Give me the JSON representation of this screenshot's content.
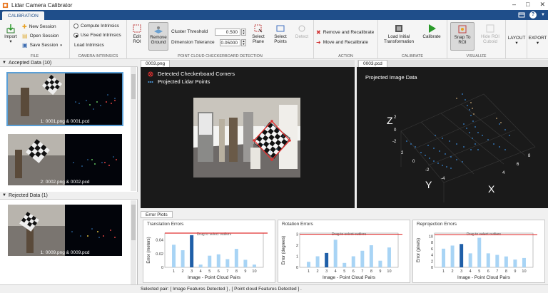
{
  "window": {
    "title": "Lidar Camera Calibrator"
  },
  "tabs": {
    "calibration": "CALIBRATION"
  },
  "ribbon": {
    "file": {
      "label": "FILE",
      "import": "Import",
      "new_session": "New Session",
      "open_session": "Open Session",
      "save_session": "Save Session"
    },
    "intrinsics": {
      "label": "CAMERA INTRINSICS",
      "compute": "Compute Intrinsics",
      "use_fixed": "Use Fixed Intrinsics",
      "load": "Load Intrinsics"
    },
    "detection": {
      "label": "POINT CLOUD CHECKERBOARD DETECTION",
      "edit_roi": "Edit ROI",
      "remove_ground": "Remove Ground",
      "cluster_threshold_label": "Cluster Threshold",
      "cluster_threshold_value": "0.500",
      "dimension_tolerance_label": "Dimension Tolerance",
      "dimension_tolerance_value": "0.05000",
      "select_plane": "Select Plane",
      "select_points": "Select Points",
      "detect": "Detect"
    },
    "action": {
      "label": "ACTION",
      "remove_recalibrate": "Remove and Recalibrate",
      "move_recalibrate": "Move and Recalibrate"
    },
    "calibrate": {
      "label": "CALIBRATE",
      "load_initial": "Load Initial Transformation",
      "calibrate": "Calibrate"
    },
    "visualize": {
      "label": "VISUALIZE",
      "snap_to_roi": "Snap To ROI",
      "hide_roi": "Hide ROI Cuboid"
    },
    "layout": {
      "label": "LAYOUT"
    },
    "export": {
      "label": "EXPORT"
    }
  },
  "left_panel": {
    "accepted_header": "Accepted Data (10)",
    "rejected_header": "Rejected Data (1)",
    "accepted": [
      {
        "caption": "1: 0001.png & 0001.pcd"
      },
      {
        "caption": "2: 0002.png & 0002.pcd"
      }
    ],
    "rejected": [
      {
        "caption": "1: 0009.png & 0009.pcd"
      }
    ]
  },
  "image_view": {
    "tab": "0003.png",
    "legend_corners": "Detected Checkerboard Corners",
    "legend_lidar": "Projected Lidar Points"
  },
  "pcd_view": {
    "tab": "0003.pcd",
    "title": "Projected Image Data",
    "axis_x": "X",
    "axis_y": "Y",
    "axis_z": "Z",
    "ticks_x": [
      "4",
      "6",
      "8"
    ],
    "ticks_y": [
      "-4",
      "-2",
      "0",
      "2"
    ],
    "ticks_z": [
      "2",
      "0",
      "-2"
    ]
  },
  "errors": {
    "tab": "Error Plots",
    "banner": "Drag to select outliers",
    "xlabel": "Image - Point Cloud Pairs",
    "colors": {
      "bar": "#a8d4f5",
      "selected": "#1f5fa8",
      "line": "#e03030"
    },
    "chart_data": [
      {
        "type": "bar",
        "title": "Translation Errors",
        "ylabel": "Error (meters)",
        "categories": [
          "1",
          "2",
          "3",
          "4",
          "5",
          "6",
          "7",
          "8",
          "9",
          "10"
        ],
        "values": [
          0.033,
          0.025,
          0.047,
          0.004,
          0.017,
          0.019,
          0.012,
          0.027,
          0.011,
          0.004
        ],
        "selected_index": 2,
        "threshold": 0.05,
        "ylim": [
          0,
          0.05
        ],
        "yticks": [
          "0",
          "0.02",
          "0.04"
        ]
      },
      {
        "type": "bar",
        "title": "Rotation Errors",
        "ylabel": "Error (degrees)",
        "categories": [
          "1",
          "2",
          "3",
          "4",
          "5",
          "6",
          "7",
          "8",
          "9",
          "10"
        ],
        "values": [
          0.5,
          1.0,
          1.3,
          2.5,
          0.4,
          1.0,
          1.5,
          2.0,
          0.6,
          1.8
        ],
        "selected_index": 2,
        "threshold": 3.0,
        "ylim": [
          0,
          3.1
        ],
        "yticks": [
          "0",
          "1",
          "2",
          "3"
        ]
      },
      {
        "type": "bar",
        "title": "Reprojection Errors",
        "ylabel": "Error (pixels)",
        "categories": [
          "1",
          "2",
          "3",
          "4",
          "5",
          "6",
          "7",
          "8",
          "9",
          "10"
        ],
        "values": [
          6.0,
          7.0,
          7.5,
          4.5,
          9.5,
          4.5,
          4.0,
          3.5,
          2.5,
          3.0
        ],
        "selected_index": 2,
        "threshold": 10.5,
        "ylim": [
          0,
          11
        ],
        "yticks": [
          "0",
          "2",
          "4",
          "6",
          "8",
          "10"
        ]
      }
    ]
  },
  "status": {
    "text": "Selected pair: [ Image Features Detected ] , [ Point cloud Features Detected ] ."
  }
}
